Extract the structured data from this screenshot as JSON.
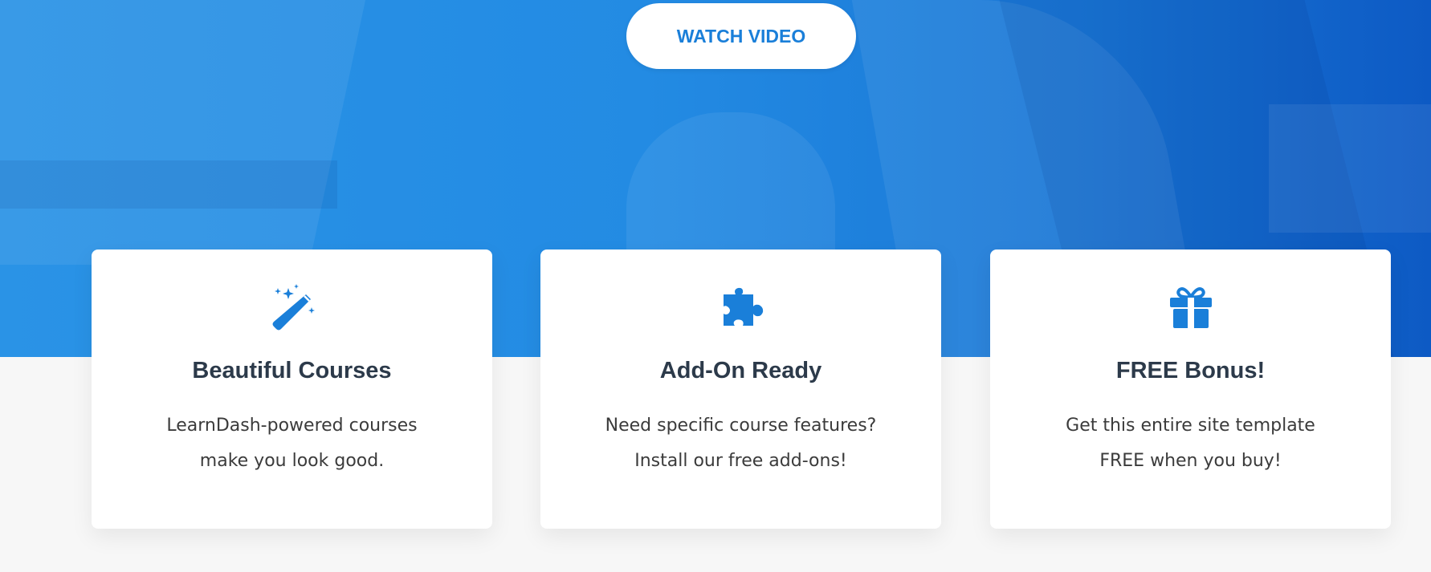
{
  "hero": {
    "button_label": "WATCH VIDEO",
    "background_color": "#238be3",
    "button_text_color": "#1a7fd9"
  },
  "features": [
    {
      "icon": "magic-wand-icon",
      "title": "Beautiful Courses",
      "line1": "LearnDash-powered courses",
      "line2": "make you look good."
    },
    {
      "icon": "puzzle-piece-icon",
      "title": "Add-On Ready",
      "line1": "Need specific course features?",
      "line2": "Install our free add-ons!"
    },
    {
      "icon": "gift-icon",
      "title": "FREE Bonus!",
      "line1": "Get this entire site template",
      "line2": "FREE when you buy!"
    }
  ],
  "colors": {
    "accent": "#1a7fd9",
    "heading": "#2c3a4a",
    "body_text": "#3b3b3b",
    "page_bg": "#f7f7f7"
  }
}
